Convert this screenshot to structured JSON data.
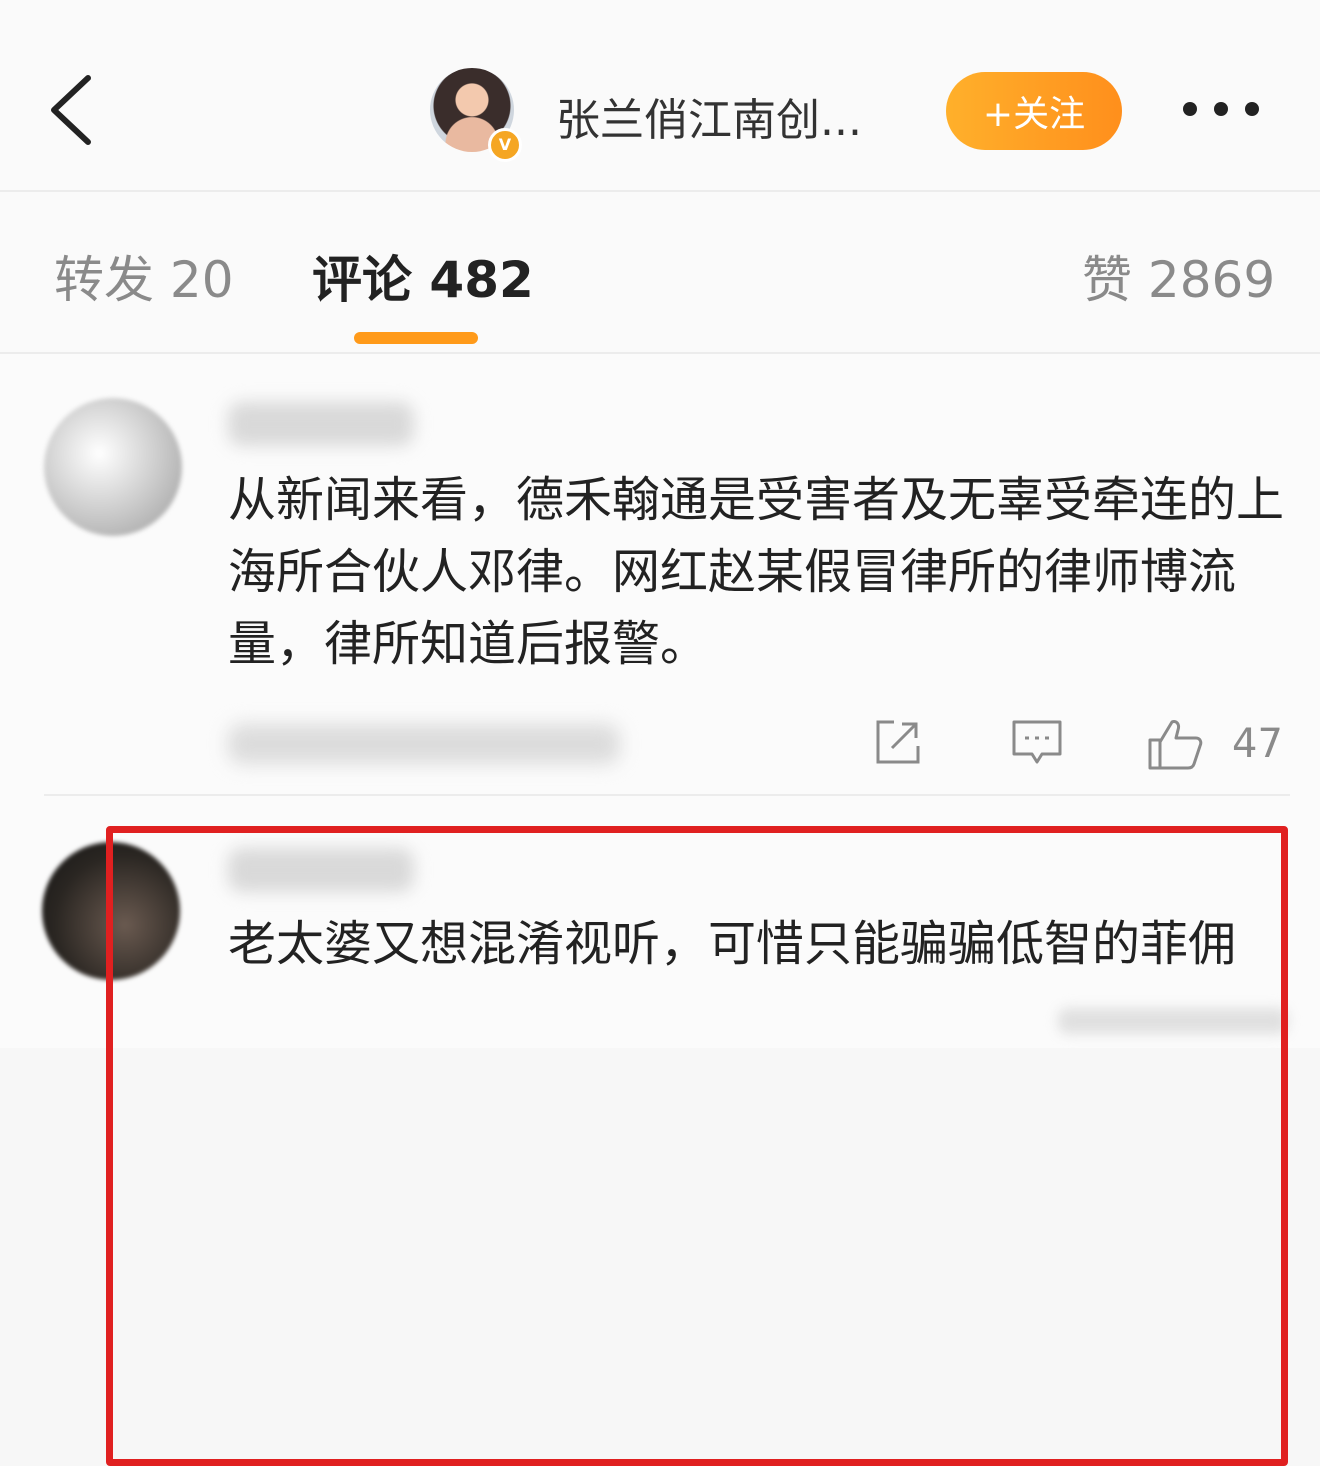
{
  "header": {
    "user_name": "张兰俏江南创...",
    "verified_badge": "V",
    "follow_label": "+关注"
  },
  "tabs": {
    "repost": "转发 20",
    "comment": "评论 482",
    "like": "赞 2869"
  },
  "comments": [
    {
      "text": "从新闻来看，德禾翰通是受害者及无辜受牵连的上海所合伙人邓律。网红赵某假冒律所的律师博流量，律所知道后报警。",
      "like_count": "47"
    },
    {
      "text": "老太婆又想混淆视听，可惜只能骗骗低智的菲佣"
    }
  ],
  "icons": {
    "back": "chevron-left-icon",
    "more": "more-dots-icon",
    "share": "share-icon",
    "reply": "comment-icon",
    "like": "thumbs-up-icon"
  },
  "colors": {
    "accent": "#ff9a1a",
    "highlight": "#e02020"
  }
}
